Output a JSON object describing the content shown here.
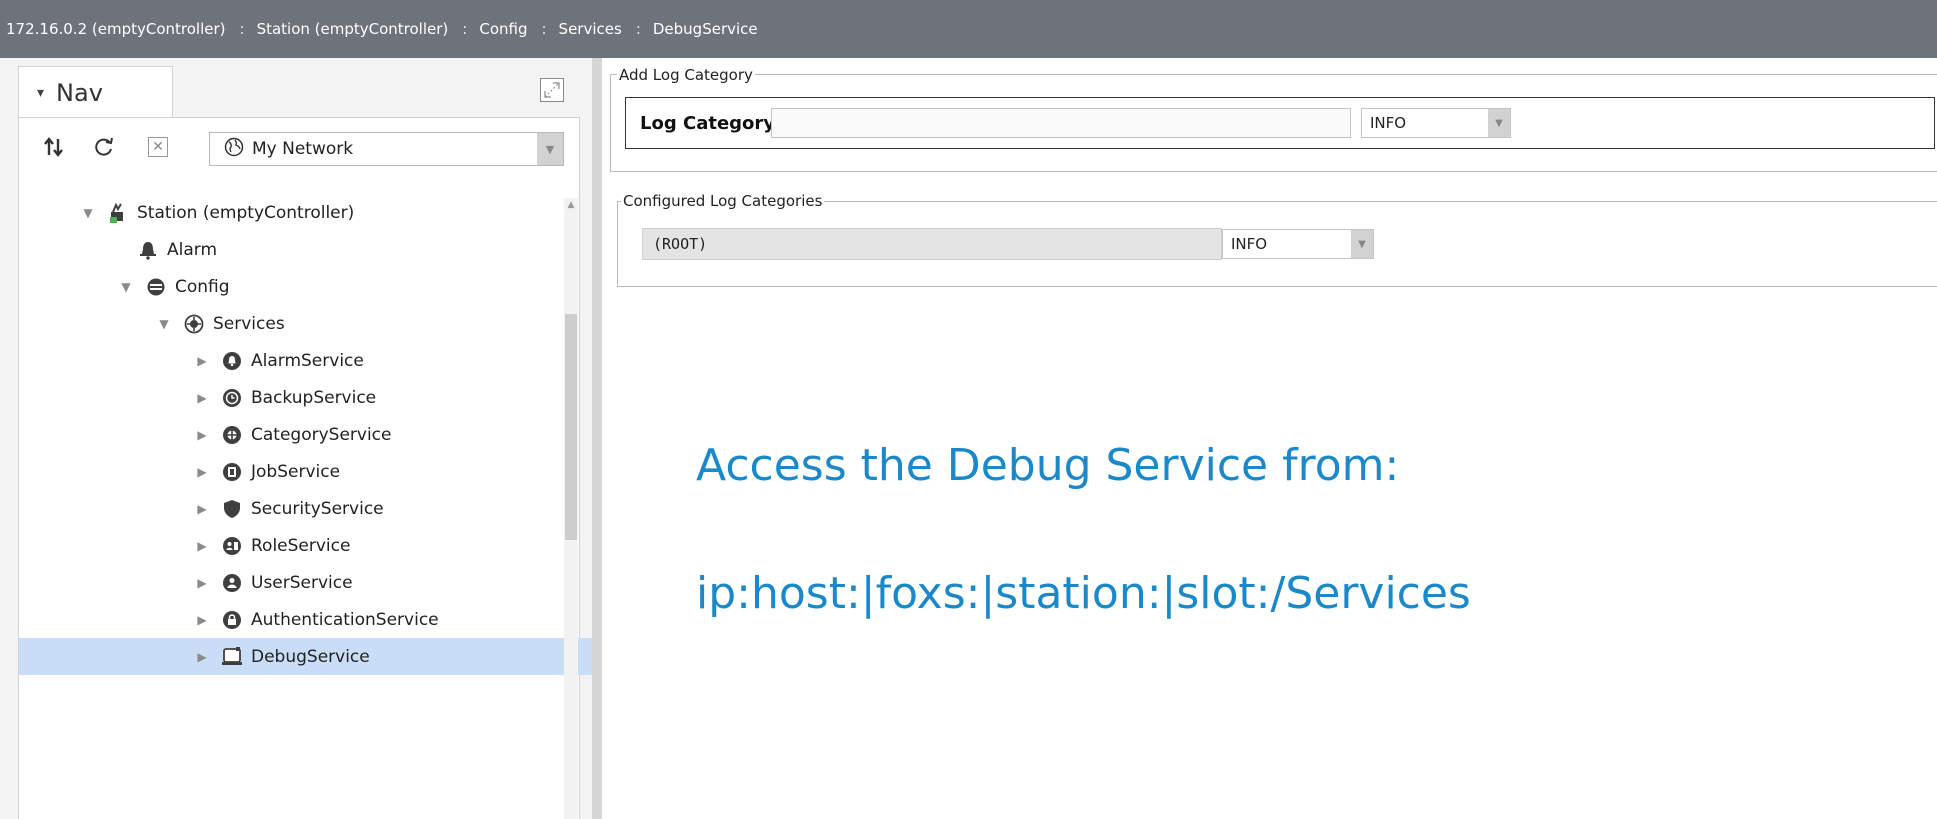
{
  "breadcrumb": [
    "172.16.0.2 (emptyController)",
    "Station (emptyController)",
    "Config",
    "Services",
    "DebugService"
  ],
  "breadcrumb_separator": ":",
  "nav": {
    "tab_label": "Nav",
    "network_select": "My Network",
    "tree": [
      {
        "label": "Station (emptyController)",
        "icon": "station-icon",
        "expander": "expanded"
      },
      {
        "label": "Alarm",
        "icon": "bell-icon",
        "expander": "none"
      },
      {
        "label": "Config",
        "icon": "database-icon",
        "expander": "expanded"
      },
      {
        "label": "Services",
        "icon": "services-icon",
        "expander": "expanded"
      },
      {
        "label": "AlarmService",
        "icon": "alarm-service-icon",
        "expander": "collapsed"
      },
      {
        "label": "BackupService",
        "icon": "backup-service-icon",
        "expander": "collapsed"
      },
      {
        "label": "CategoryService",
        "icon": "category-service-icon",
        "expander": "collapsed"
      },
      {
        "label": "JobService",
        "icon": "job-service-icon",
        "expander": "collapsed"
      },
      {
        "label": "SecurityService",
        "icon": "shield-icon",
        "expander": "collapsed"
      },
      {
        "label": "RoleService",
        "icon": "role-service-icon",
        "expander": "collapsed"
      },
      {
        "label": "UserService",
        "icon": "user-service-icon",
        "expander": "collapsed"
      },
      {
        "label": "AuthenticationService",
        "icon": "lock-icon",
        "expander": "collapsed"
      },
      {
        "label": "DebugService",
        "icon": "debug-service-icon",
        "expander": "collapsed",
        "selected": true
      }
    ]
  },
  "add_log_category": {
    "legend": "Add Log Category",
    "field_label": "Log Category",
    "field_value": "",
    "level": "INFO"
  },
  "configured": {
    "legend": "Configured Log Categories",
    "rows": [
      {
        "category": "(ROOT)",
        "level": "INFO"
      }
    ]
  },
  "caption": {
    "line1": "Access the Debug Service from:",
    "line2": "ip:host:|foxs:|station:|slot:/Services"
  },
  "colors": {
    "breadcrumb_bar": "#6e737b",
    "selection": "#c9ddf7",
    "caption": "#1a88c9"
  }
}
